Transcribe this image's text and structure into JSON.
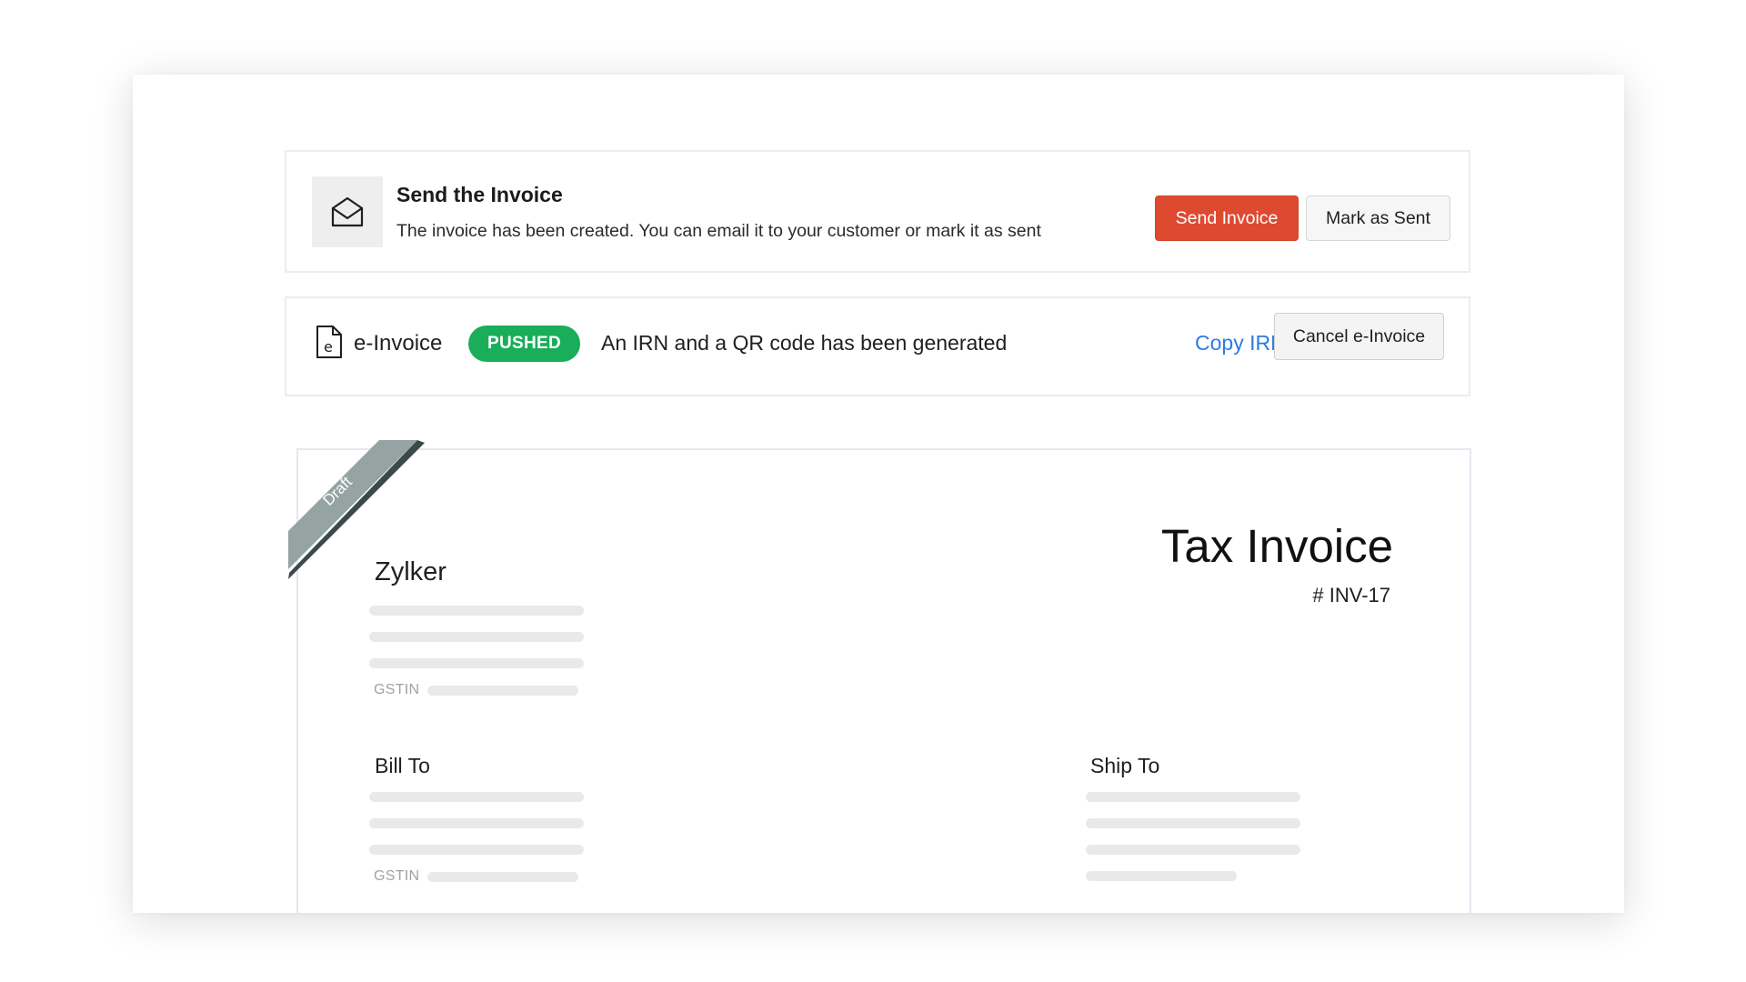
{
  "send_banner": {
    "title": "Send the Invoice",
    "description": "The invoice has been created. You can email it to your customer or mark it as sent",
    "send_button": "Send Invoice",
    "mark_sent_button": "Mark as Sent",
    "icon": "envelope-open-icon"
  },
  "einvoice_banner": {
    "label": "e-Invoice",
    "status_badge": "PUSHED",
    "message": "An IRN and a QR code has been generated",
    "copy_link": "Copy IRN",
    "cancel_button": "Cancel e-Invoice",
    "icon": "e-invoice-document-icon"
  },
  "invoice": {
    "ribbon_label": "Draft",
    "company_name": "Zylker",
    "title": "Tax Invoice",
    "number": "# INV-17",
    "gstin_label": "GSTIN",
    "bill_to_label": "Bill To",
    "ship_to_label": "Ship To"
  },
  "colors": {
    "primary_button": "#de4a30",
    "status_badge": "#1aae5b",
    "link": "#2c7be5",
    "ribbon": "#95a4a2",
    "placeholder": "#e9e9e9"
  }
}
